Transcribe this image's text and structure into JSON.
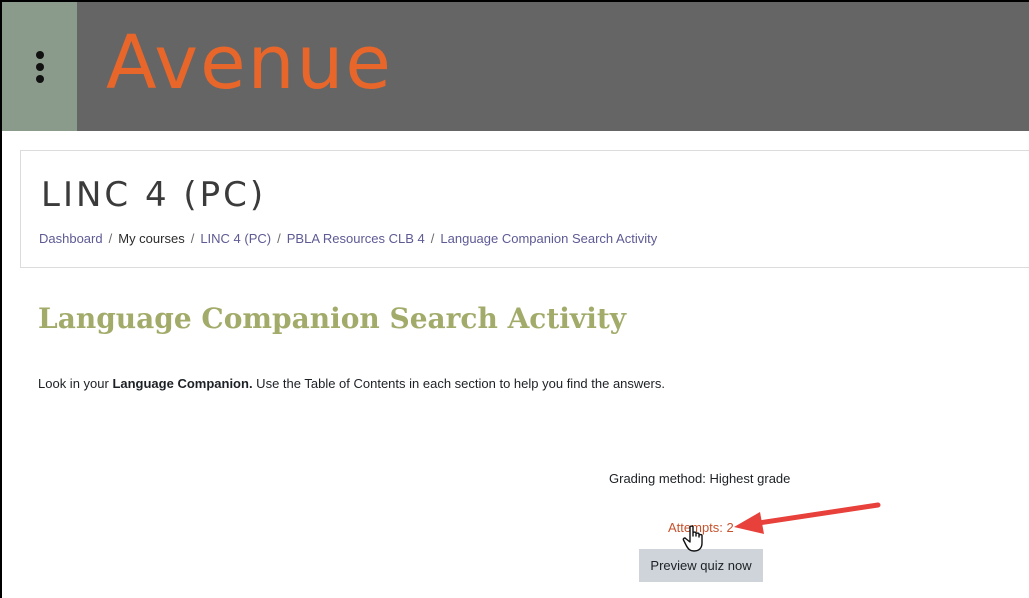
{
  "header": {
    "logo_text": "Avenue",
    "logo_color": "#e8662a",
    "bar_color": "#656565",
    "menu_icon": "kebab-vertical-icon"
  },
  "course": {
    "title": "LINC 4 (PC)"
  },
  "breadcrumb": {
    "items": [
      {
        "label": "Dashboard"
      },
      {
        "label": "My courses"
      },
      {
        "label": "LINC 4 (PC)"
      },
      {
        "label": "PBLA Resources CLB 4"
      },
      {
        "label": "Language Companion Search Activity"
      }
    ],
    "separator": "/"
  },
  "main": {
    "heading": "Language Companion Search Activity",
    "intro_prefix": "Look in your ",
    "intro_bold": "Language Companion.",
    "intro_suffix": " Use the Table of Contents in each section to help you find the answers.",
    "grading_method": "Grading method: Highest grade",
    "attempts": "Attempts: 2",
    "preview_button": "Preview quiz now"
  },
  "annotations": {
    "arrow_color": "#e8403a",
    "cursor_icon": "hand-pointer-icon"
  }
}
